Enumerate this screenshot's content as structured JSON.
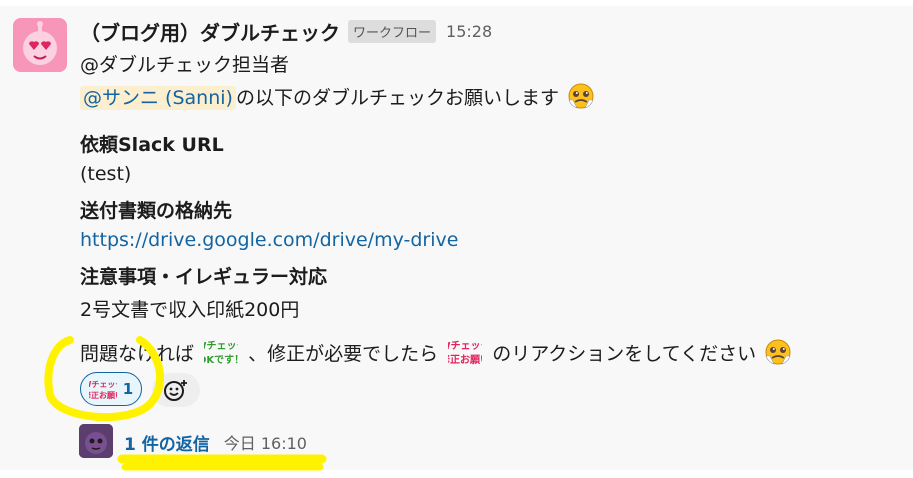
{
  "message": {
    "sender": "（ブログ用）ダブルチェック",
    "app_badge": "ワークフロー",
    "time": "15:28",
    "line_mention_group": "@ダブルチェック担当者",
    "mention_user": "@サンニ (Sanni)",
    "request_text": "の以下のダブルチェックお願いします",
    "label_slack_url": "依頼Slack URL",
    "value_slack_url": "(test)",
    "label_storage": "送付書類の格納先",
    "value_storage_link": "https://drive.google.com/drive/my-drive",
    "label_notes": "注意事項・イレギュラー対応",
    "value_notes": "2号文書で収入印紙200円",
    "closing_part1": "問題なければ",
    "closing_part2": "、修正が必要でしたら",
    "closing_part3": "のリアクションをしてください"
  },
  "emojis": {
    "ok_emoji": {
      "line1": "Wチェック",
      "line2": "OKです！"
    },
    "fix_emoji": {
      "line1": "Wチェック",
      "line2": "修正お願い"
    }
  },
  "reaction": {
    "count": "1",
    "emoji": {
      "line1": "Wチェック",
      "line2": "修正お願い"
    }
  },
  "thread": {
    "reply_label": "1 件の返信",
    "reply_time": "今日 16:10"
  },
  "colors": {
    "link": "#1264a3",
    "mention_bg": "#fcefd0",
    "highlight_yellow": "#fff200",
    "avatar_pink": "#f796b8"
  }
}
